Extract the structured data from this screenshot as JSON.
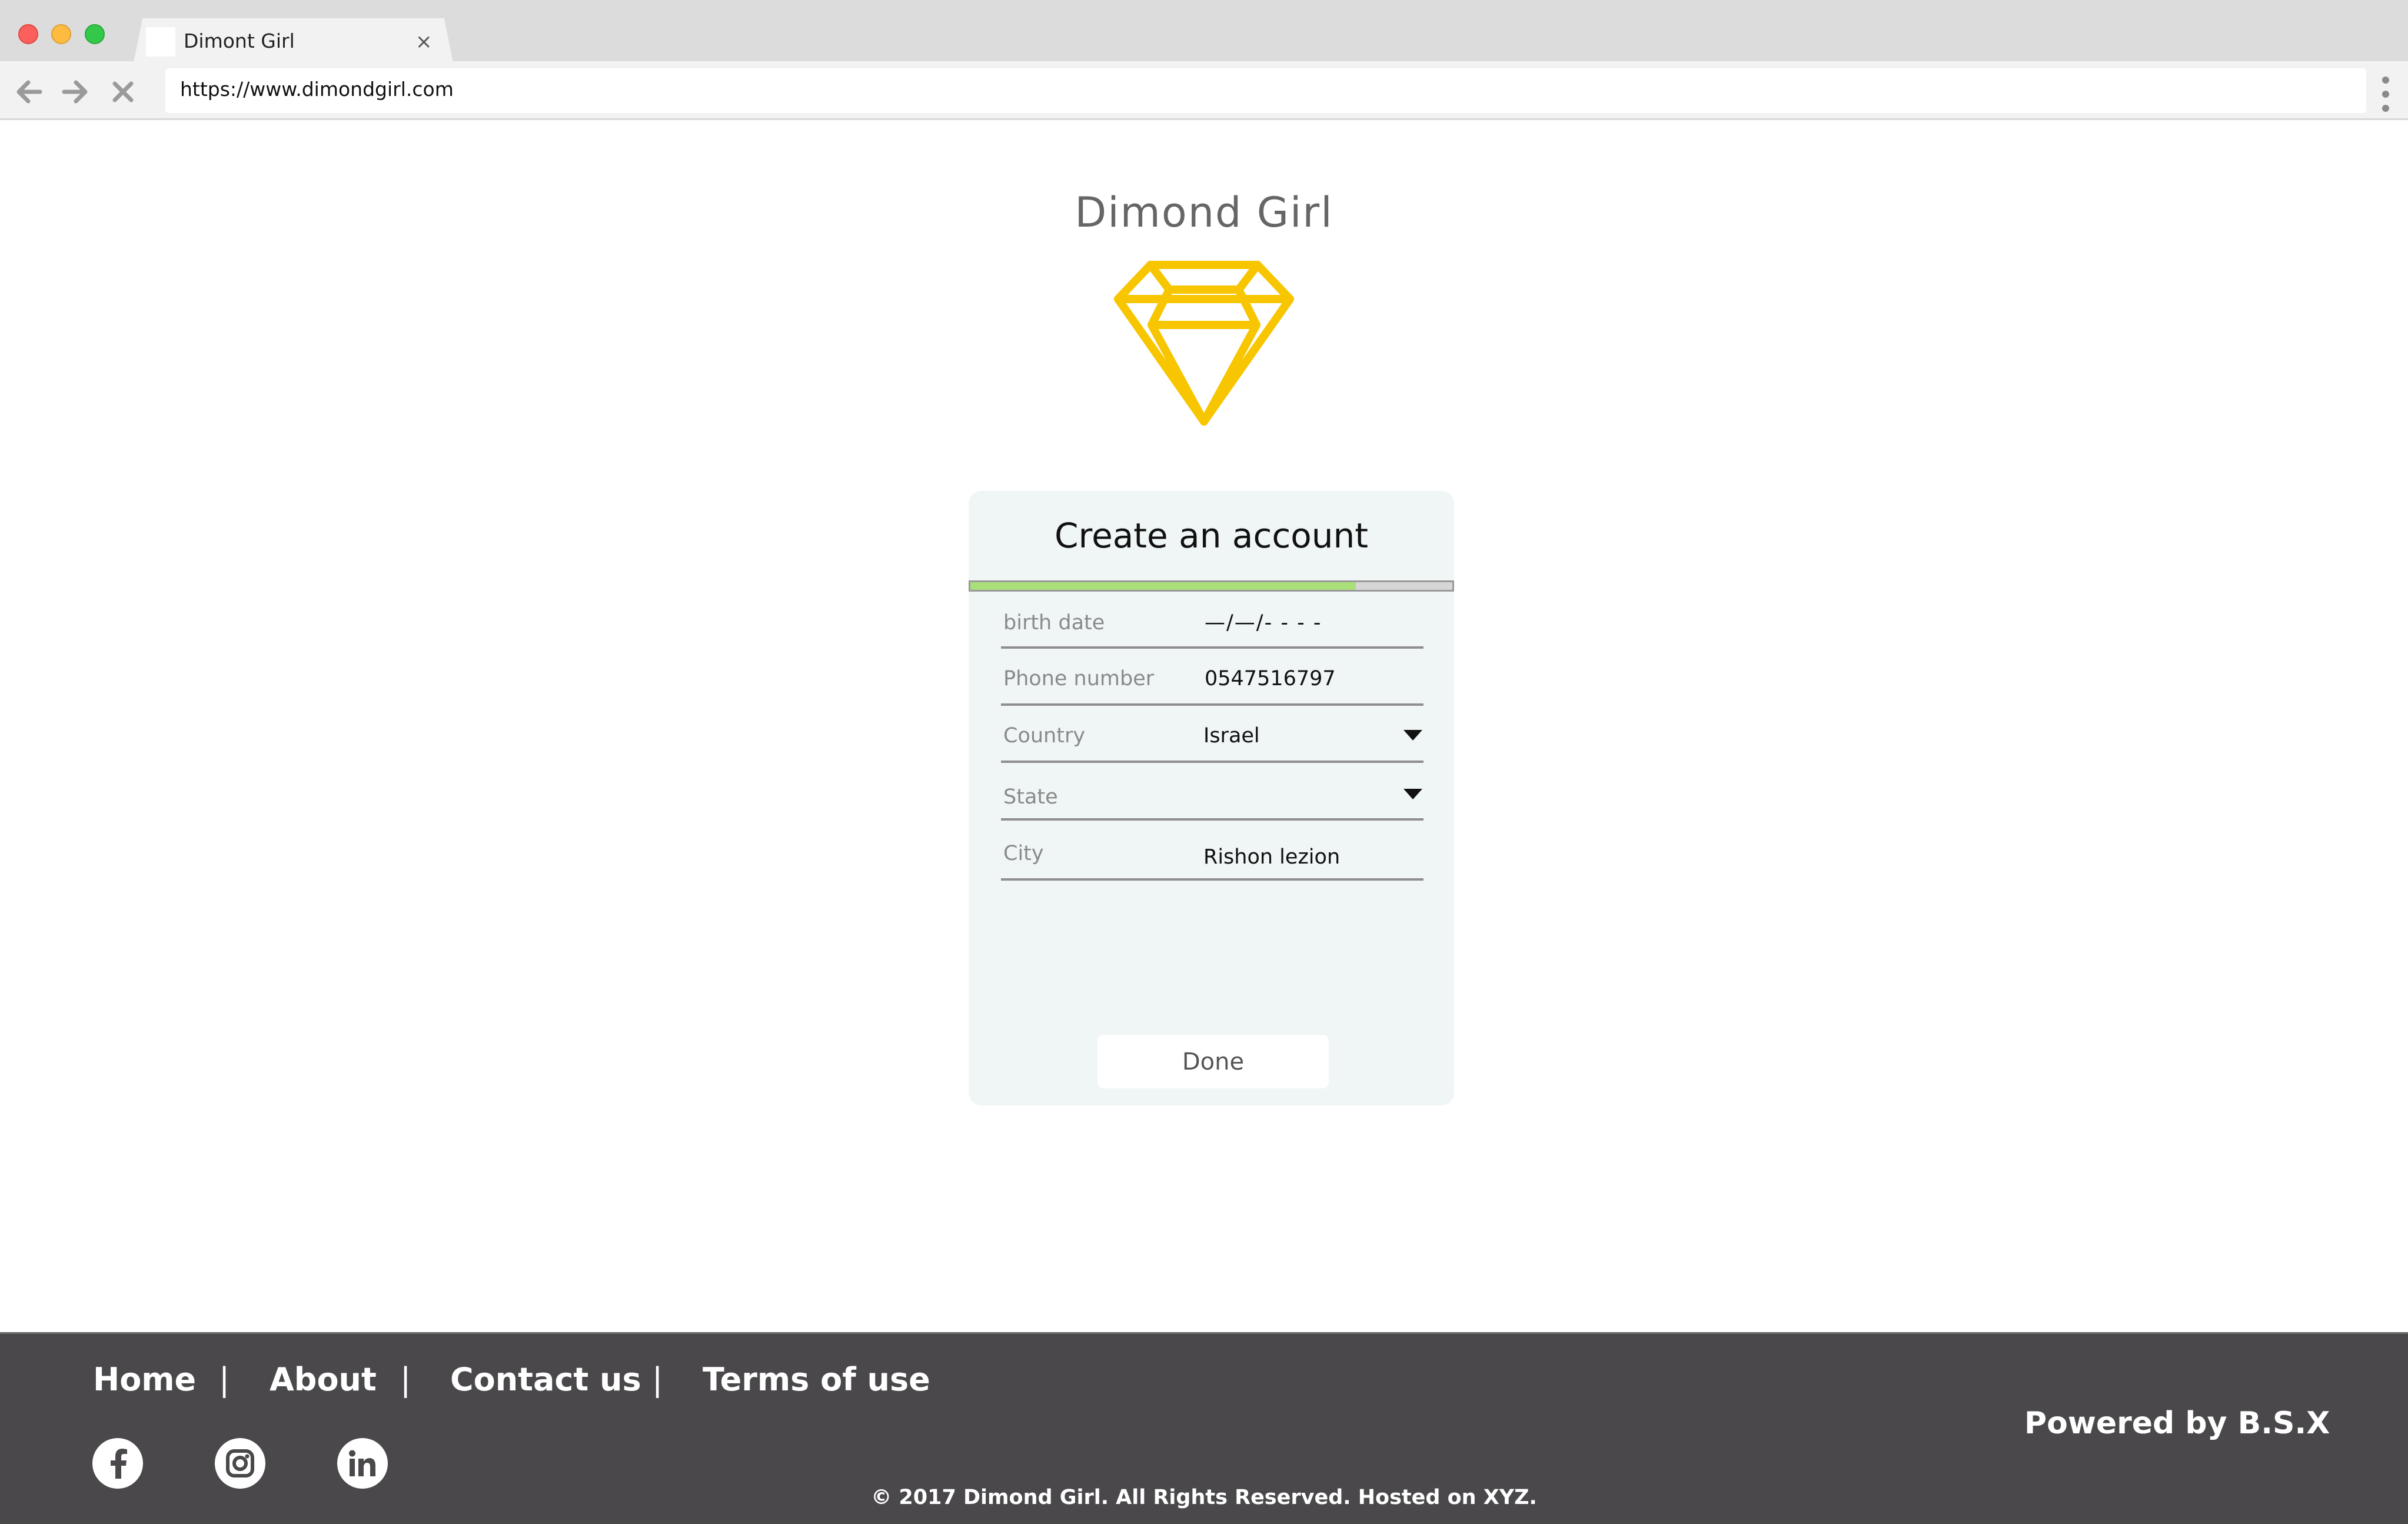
{
  "browser": {
    "tab_title": "Dimont Girl",
    "tab_close": "×",
    "url": "https://www.dimondgirl.com"
  },
  "brand": {
    "title": "Dimond Girl",
    "logo_icon": "diamond-icon",
    "logo_color": "#f8c600"
  },
  "form": {
    "title": "Create an account",
    "progress_fraction": 0.8,
    "progress_color": "#a9e07a",
    "fields": [
      {
        "label": "birth date",
        "value": "—/—/- - - -",
        "type": "date"
      },
      {
        "label": "Phone number",
        "value": "0547516797",
        "type": "text"
      },
      {
        "label": "Country",
        "value": "Israel",
        "type": "select"
      },
      {
        "label": "State",
        "value": "",
        "type": "select"
      },
      {
        "label": "City",
        "value": "Rishon lezion",
        "type": "text"
      }
    ],
    "submit_label": "Done"
  },
  "footer": {
    "links": [
      "Home",
      "About",
      "Contact us",
      "Terms of use"
    ],
    "separator": "|",
    "social": [
      "facebook-icon",
      "instagram-icon",
      "linkedin-icon"
    ],
    "powered_by": "Powered by B.S.X",
    "copyright": "© 2017 Dimond Girl. All Rights Reserved. Hosted on XYZ.",
    "background": "#4a484b"
  }
}
